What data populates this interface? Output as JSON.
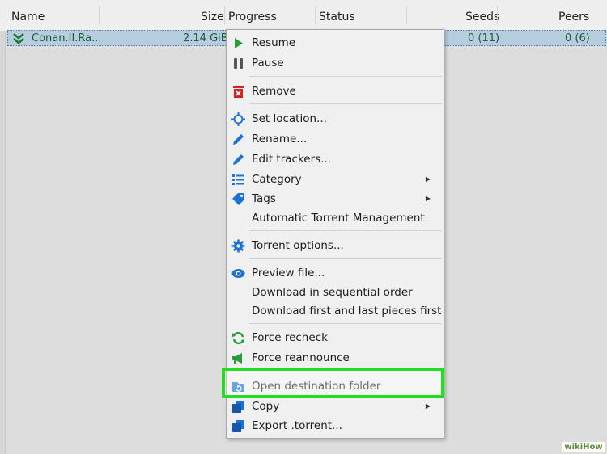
{
  "header": {
    "columns": [
      {
        "label": "Name"
      },
      {
        "label": "Size"
      },
      {
        "label": "Progress"
      },
      {
        "label": "Status"
      },
      {
        "label": "Seeds"
      },
      {
        "label": "Peers"
      }
    ]
  },
  "torrent_row": {
    "name": "Conan.II.Ra...",
    "size": "2.14 GiB",
    "seeds": "0 (11)",
    "peers": "0 (6)"
  },
  "context_menu": {
    "items": [
      {
        "label": "Resume",
        "icon": "play-icon"
      },
      {
        "label": "Pause",
        "icon": "pause-icon"
      },
      {
        "label": "Remove",
        "icon": "trash-icon"
      },
      {
        "label": "Set location...",
        "icon": "crosshair-icon"
      },
      {
        "label": "Rename...",
        "icon": "pencil-icon"
      },
      {
        "label": "Edit trackers...",
        "icon": "pencil-icon"
      },
      {
        "label": "Category",
        "icon": "list-icon"
      },
      {
        "label": "Tags",
        "icon": "tag-icon"
      },
      {
        "label": "Automatic Torrent Management"
      },
      {
        "label": "Torrent options...",
        "icon": "gear-icon"
      },
      {
        "label": "Preview file...",
        "icon": "eye-icon"
      },
      {
        "label": "Download in sequential order"
      },
      {
        "label": "Download first and last pieces first"
      },
      {
        "label": "Force recheck",
        "icon": "refresh-icon"
      },
      {
        "label": "Force reannounce",
        "icon": "megaphone-icon"
      },
      {
        "label": "Open destination folder",
        "icon": "folder-open-icon"
      },
      {
        "label": "Copy",
        "icon": "copy-icon"
      },
      {
        "label": "Export .torrent...",
        "icon": "export-icon"
      }
    ]
  },
  "watermark": {
    "text": "wikiHow"
  },
  "colors": {
    "highlight": "#22dd22",
    "selected_row": "#b6cde0",
    "icon_blue": "#1e73d2",
    "icon_green": "#2a9a3a"
  }
}
